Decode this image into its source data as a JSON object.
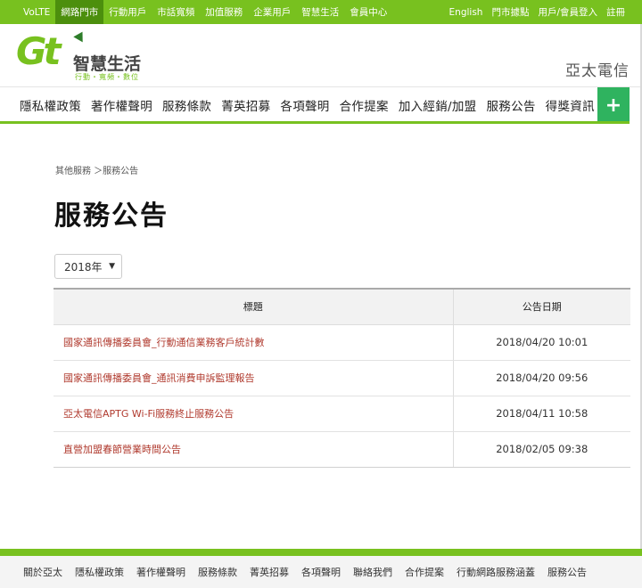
{
  "topbar": {
    "left": [
      {
        "label": "VoLTE",
        "active": false
      },
      {
        "label": "網路門市",
        "active": true
      },
      {
        "label": "行動用戶",
        "active": false
      },
      {
        "label": "市話寬頻",
        "active": false
      },
      {
        "label": "加值服務",
        "active": false
      },
      {
        "label": "企業用戶",
        "active": false
      },
      {
        "label": "智慧生活",
        "active": false
      },
      {
        "label": "會員中心",
        "active": false
      }
    ],
    "right": [
      "English",
      "門市據點",
      "用戶/會員登入",
      "註冊"
    ]
  },
  "header": {
    "logo_mark": "Gt",
    "logo_slogan": "智慧生活",
    "logo_sub": "行動・寬頻・數位",
    "brand": "亞太電信"
  },
  "mainnav": {
    "items": [
      "隱私權政策",
      "著作權聲明",
      "服務條款",
      "菁英招募",
      "各項聲明",
      "合作提案",
      "加入經銷/加盟",
      "服務公告",
      "得獎資訊"
    ],
    "plus": "+"
  },
  "breadcrumb": "其他服務 ＞服務公告",
  "page_title": "服務公告",
  "year_select": {
    "value": "2018年",
    "caret": "▼"
  },
  "table": {
    "headers": [
      "標題",
      "公告日期"
    ],
    "rows": [
      {
        "title": "國家通訊傳播委員會_行動通信業務客戶統計數",
        "date": "2018/04/20 10:01"
      },
      {
        "title": "國家通訊傳播委員會_通訊消費申訴監理報告",
        "date": "2018/04/20 09:56"
      },
      {
        "title": "亞太電信APTG Wi-Fi服務終止服務公告",
        "date": "2018/04/11 10:58"
      },
      {
        "title": "直營加盟春節營業時間公告",
        "date": "2018/02/05 09:38"
      }
    ]
  },
  "footer": [
    "關於亞太",
    "隱私權政策",
    "著作權聲明",
    "服務條款",
    "菁英招募",
    "各項聲明",
    "聯絡我們",
    "合作提案",
    "行動網路服務涵蓋",
    "服務公告"
  ],
  "colors": {
    "brand_green": "#78c11f",
    "link_red": "#b03a2e",
    "plus_green": "#2fb35f"
  }
}
